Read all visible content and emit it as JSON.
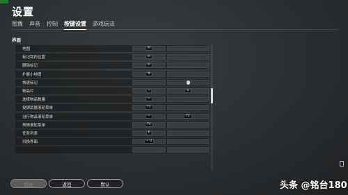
{
  "title": "设置",
  "tabs": [
    {
      "label": "图像",
      "active": false
    },
    {
      "label": "声音",
      "active": false
    },
    {
      "label": "控制",
      "active": false
    },
    {
      "label": "按键设置",
      "active": true
    },
    {
      "label": "游戏玩法",
      "active": false
    }
  ],
  "section": "界面",
  "rows": [
    {
      "label": "地图",
      "primary": "M",
      "secondary": ""
    },
    {
      "label": "标记我的位置",
      "primary": "m",
      "secondary": ""
    },
    {
      "label": "删除标记",
      "primary": "m",
      "secondary": ""
    },
    {
      "label": "扩展小地图",
      "primary": "N",
      "secondary": ""
    },
    {
      "label": "快速标记",
      "primary": "",
      "secondary": "mouse"
    },
    {
      "label": "物品栏",
      "primary": "I",
      "secondary": "⇆"
    },
    {
      "label": "选择物品数量",
      "primary": "~",
      "secondary": ""
    },
    {
      "label": "投掷武器滚轮菜单",
      "primary": "T1",
      "secondary": ""
    },
    {
      "label": "治疗物品滚轮菜单",
      "primary": "~",
      "secondary": "T2"
    },
    {
      "label": "表情滚轮菜单",
      "primary": "T4",
      "secondary": ""
    },
    {
      "label": "任务列表",
      "primary": "P",
      "secondary": ""
    },
    {
      "label": "切换界面",
      "primary": "~ U",
      "secondary": ""
    },
    {
      "label": "",
      "primary": "",
      "secondary": ""
    }
  ],
  "buttons": {
    "back": "后退",
    "return": "返回",
    "default": "默认"
  },
  "watermark": "头条 @铭台180",
  "colors": {
    "accent": "#ffffff",
    "background": "#2b2e30",
    "badge": "#1d7a2a"
  }
}
